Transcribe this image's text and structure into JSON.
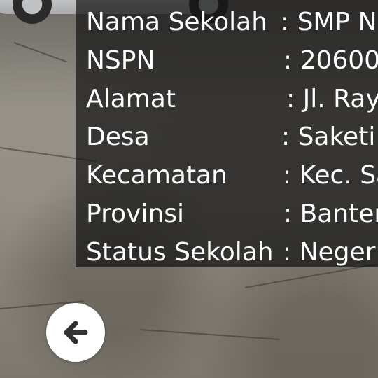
{
  "school_info": {
    "rows": [
      {
        "label": "Nama Sekolah",
        "value": ": SMP N"
      },
      {
        "label": "NSPN",
        "value": ": 20600"
      },
      {
        "label": "Alamat",
        "value": ": Jl. Ray"
      },
      {
        "label": "Desa",
        "value": ": Saketi"
      },
      {
        "label": "Kecamatan",
        "value": ": Kec. Sa"
      },
      {
        "label": "Provinsi",
        "value": ": Banter"
      },
      {
        "label": "Status Sekolah",
        "value": ": Neger"
      }
    ]
  },
  "back_button": {
    "icon": "arrow-left-icon"
  },
  "colors": {
    "panel": "#141414",
    "text": "#ffffff",
    "button": "#ffffff",
    "icon": "#333333"
  }
}
